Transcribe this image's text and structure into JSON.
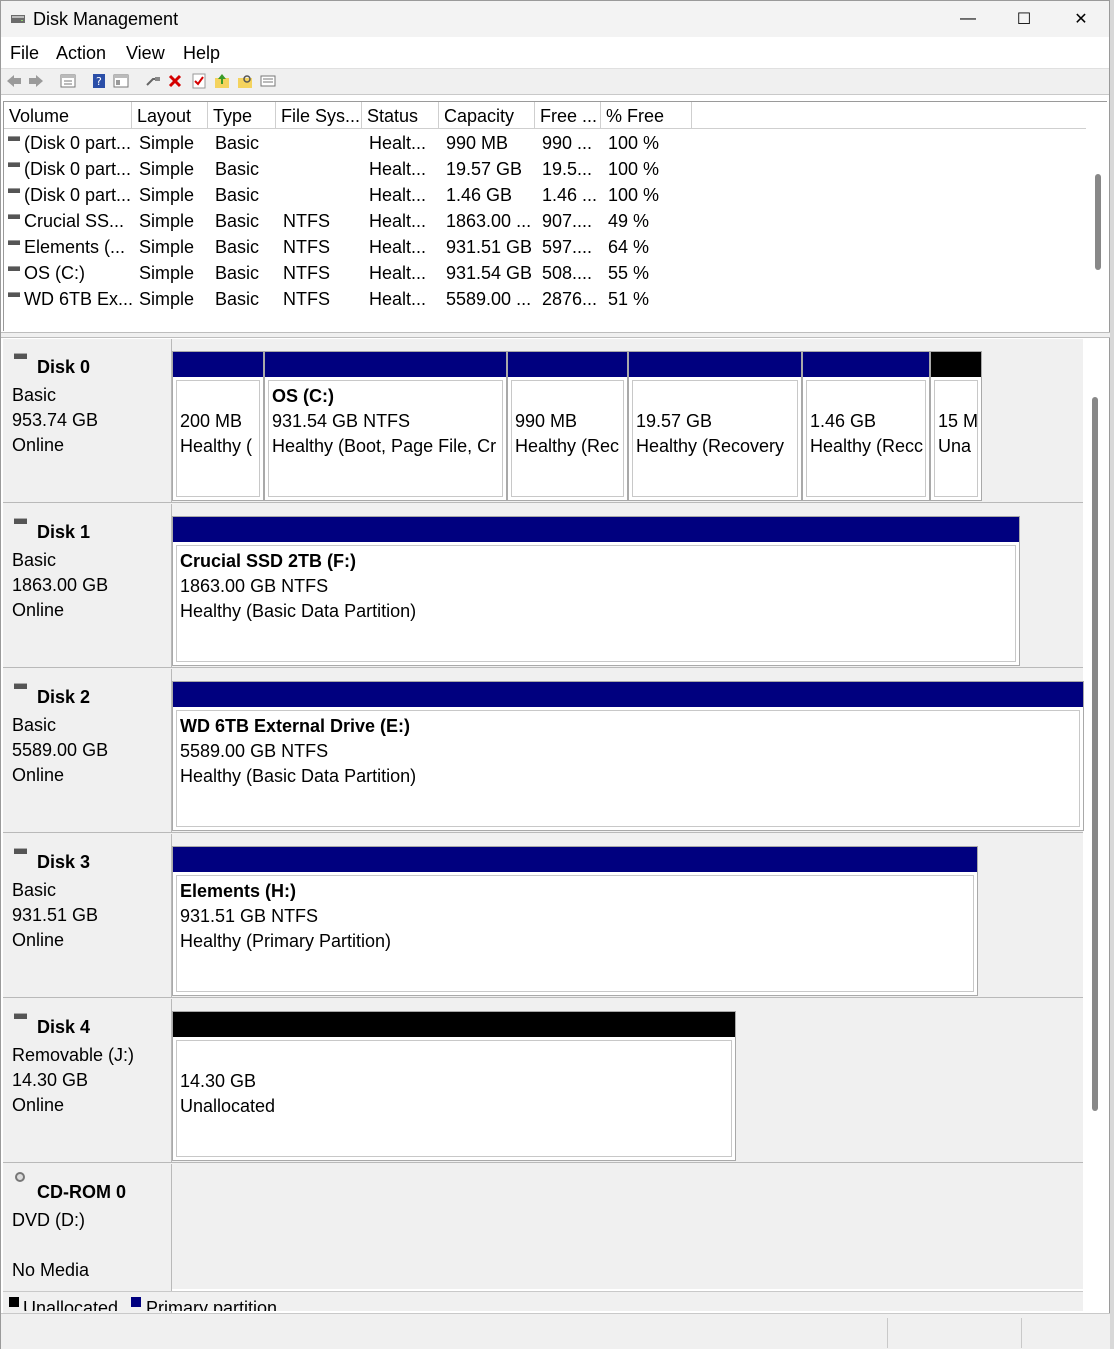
{
  "window": {
    "title": "Disk Management"
  },
  "window_controls": {
    "minimize": "—",
    "maximize": "☐",
    "close": "✕"
  },
  "menu": [
    "File",
    "Action",
    "View",
    "Help"
  ],
  "toolbar_icons": [
    "back-icon",
    "forward-icon",
    "console-tree-icon",
    "help-icon",
    "properties-icon",
    "connect-icon",
    "delete-icon",
    "check-icon",
    "up-folder-icon",
    "search-folder-icon",
    "list-view-icon"
  ],
  "list": {
    "headers": [
      "Volume",
      "Layout",
      "Type",
      "File Sys...",
      "Status",
      "Capacity",
      "Free ...",
      "% Free"
    ],
    "rows": [
      [
        "(Disk 0 part...",
        "Simple",
        "Basic",
        "",
        "Healt...",
        "990 MB",
        "990 ...",
        "100 %"
      ],
      [
        "(Disk 0 part...",
        "Simple",
        "Basic",
        "",
        "Healt...",
        "19.57 GB",
        "19.5...",
        "100 %"
      ],
      [
        "(Disk 0 part...",
        "Simple",
        "Basic",
        "",
        "Healt...",
        "1.46 GB",
        "1.46 ...",
        "100 %"
      ],
      [
        "Crucial SS...",
        "Simple",
        "Basic",
        "NTFS",
        "Healt...",
        "1863.00 ...",
        "907....",
        "49 %"
      ],
      [
        "Elements (...",
        "Simple",
        "Basic",
        "NTFS",
        "Healt...",
        "931.51 GB",
        "597....",
        "64 %"
      ],
      [
        "OS (C:)",
        "Simple",
        "Basic",
        "NTFS",
        "Healt...",
        "931.54 GB",
        "508....",
        "55 %"
      ],
      [
        "WD 6TB Ex...",
        "Simple",
        "Basic",
        "NTFS",
        "Healt...",
        "5589.00 ...",
        "2876...",
        "51 %"
      ]
    ]
  },
  "disks": [
    {
      "name": "Disk 0",
      "type": "Basic",
      "size": "953.74 GB",
      "status": "Online",
      "partitions": [
        {
          "name": "",
          "size": "200 MB",
          "desc": "Healthy ("
        },
        {
          "name": "OS  (C:)",
          "size": "931.54 GB NTFS",
          "desc": "Healthy (Boot, Page File, Cr"
        },
        {
          "name": "",
          "size": "990 MB",
          "desc": "Healthy (Rec"
        },
        {
          "name": "",
          "size": "19.57 GB",
          "desc": "Healthy (Recovery"
        },
        {
          "name": "",
          "size": "1.46 GB",
          "desc": "Healthy (Recc"
        },
        {
          "name": "",
          "size": "15 M",
          "desc": "Una"
        }
      ]
    },
    {
      "name": "Disk 1",
      "type": "Basic",
      "size": "1863.00 GB",
      "status": "Online",
      "partitions": [
        {
          "name": "Crucial SSD 2TB  (F:)",
          "size": "1863.00 GB NTFS",
          "desc": "Healthy (Basic Data Partition)"
        }
      ]
    },
    {
      "name": "Disk 2",
      "type": "Basic",
      "size": "5589.00 GB",
      "status": "Online",
      "partitions": [
        {
          "name": "WD 6TB External Drive  (E:)",
          "size": "5589.00 GB NTFS",
          "desc": "Healthy (Basic Data Partition)"
        }
      ]
    },
    {
      "name": "Disk 3",
      "type": "Basic",
      "size": "931.51 GB",
      "status": "Online",
      "partitions": [
        {
          "name": "Elements  (H:)",
          "size": "931.51 GB NTFS",
          "desc": "Healthy (Primary Partition)"
        }
      ]
    },
    {
      "name": "Disk 4",
      "type": "Removable (J:)",
      "size": "14.30 GB",
      "status": "Online",
      "partitions": [
        {
          "name": "",
          "size": "14.30 GB",
          "desc": "Unallocated"
        }
      ]
    },
    {
      "name": "CD-ROM 0",
      "type": "DVD (D:)",
      "size": "",
      "status": "No Media",
      "partitions": []
    }
  ],
  "legend": {
    "unallocated": "Unallocated",
    "primary": "Primary partition"
  },
  "colors": {
    "primary": "#00007f",
    "unallocated": "#000000"
  }
}
